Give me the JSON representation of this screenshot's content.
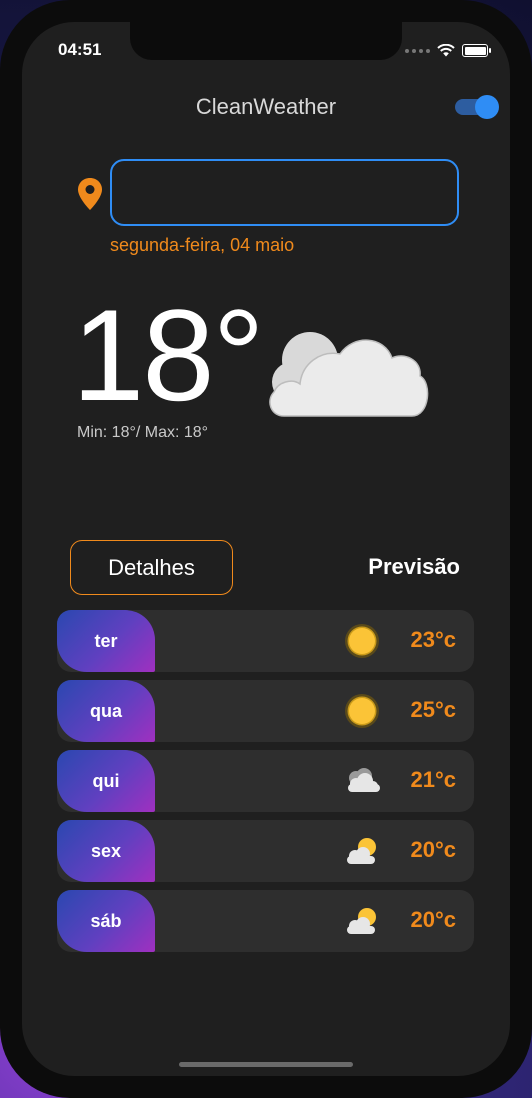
{
  "status_bar": {
    "time": "04:51"
  },
  "app": {
    "title": "CleanWeather",
    "theme_toggle_on": true
  },
  "location": {
    "value": "",
    "placeholder": ""
  },
  "date": "segunda-feira, 04 maio",
  "current": {
    "temperature": "18°",
    "minmax": "Min: 18°/ Max: 18°",
    "condition_icon": "cloudy-icon"
  },
  "tabs": {
    "details": "Detalhes",
    "forecast": "Previsão"
  },
  "forecast": [
    {
      "day": "ter",
      "icon": "sun-icon",
      "temp": "23°c"
    },
    {
      "day": "qua",
      "icon": "sun-icon",
      "temp": "25°c"
    },
    {
      "day": "qui",
      "icon": "cloud-icon",
      "temp": "21°c"
    },
    {
      "day": "sex",
      "icon": "partly-cloudy-icon",
      "temp": "20°c"
    },
    {
      "day": "sáb",
      "icon": "partly-cloudy-icon",
      "temp": "20°c"
    }
  ],
  "colors": {
    "accent": "#f08a1c",
    "blue": "#2f8df5",
    "background": "#1f1f1f"
  }
}
